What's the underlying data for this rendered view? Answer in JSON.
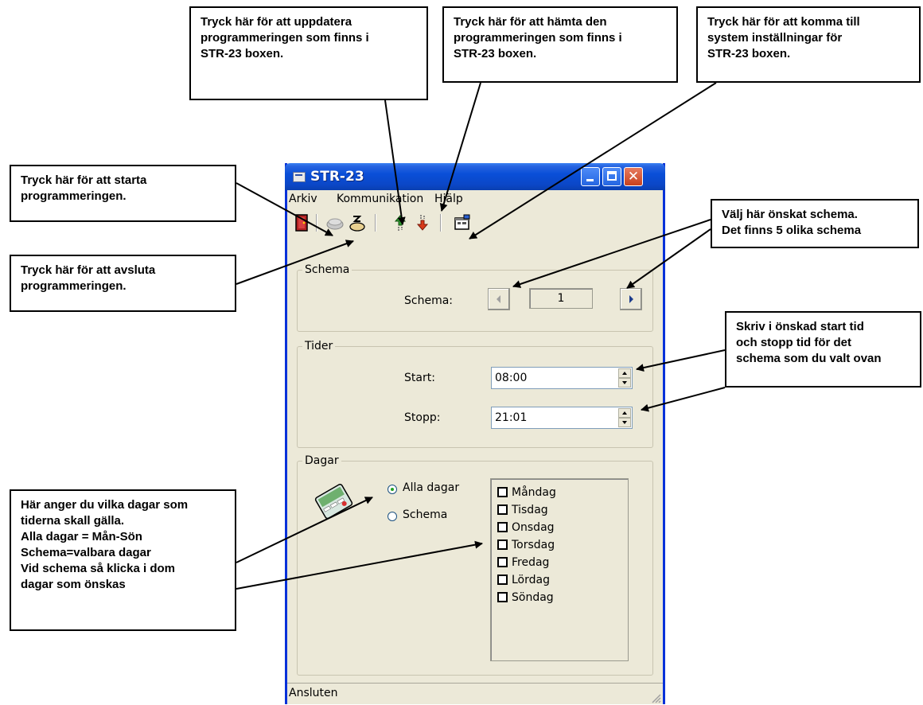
{
  "callouts": {
    "update": "Tryck här för att  uppdatera\nprogrammeringen som finns i\nSTR-23 boxen.",
    "fetch": "Tryck här för att  hämta den\nprogrammeringen som finns i\nSTR-23 boxen.",
    "settings": "Tryck här för att  komma till\nsystem inställningar för\nSTR-23 boxen.",
    "start": "Tryck här för att starta\nprogrammeringen.",
    "exit": "Tryck här för att avsluta\nprogrammeringen.",
    "schedule": "Välj här önskat schema.\nDet finns 5 olika schema",
    "times": "Skriv i önskad start tid\noch stopp tid för det\nschema som du valt  ovan",
    "days": "Här anger du vilka dagar som\ntiderna skall gälla.\nAlla dagar = Mån-Sön\nSchema=valbara dagar\nVid schema så klicka i dom\ndagar som önskas"
  },
  "window": {
    "title": "STR-23",
    "menu": [
      "Arkiv",
      "Kommunikation",
      "Hjälp"
    ],
    "schema_group": {
      "legend": "Schema",
      "label": "Schema:",
      "value": "1"
    },
    "times_group": {
      "legend": "Tider",
      "start_label": "Start:",
      "start_value": "08:00",
      "stop_label": "Stopp:",
      "stop_value": "21:01"
    },
    "days_group": {
      "legend": "Dagar",
      "radio_all": "Alla dagar",
      "radio_schema": "Schema",
      "selected": "Alla dagar",
      "days": [
        "Måndag",
        "Tisdag",
        "Onsdag",
        "Torsdag",
        "Fredag",
        "Lördag",
        "Söndag"
      ]
    },
    "status": "Ansluten"
  },
  "colors": {
    "titlebar": "#0A4FD8",
    "window_bg": "#ECE9D8",
    "arrow": "#000000"
  },
  "icons": [
    "exit-door-icon",
    "connect-icon",
    "disconnect-icon",
    "upload-icon",
    "download-icon",
    "settings-icon",
    "calendar-icon"
  ]
}
